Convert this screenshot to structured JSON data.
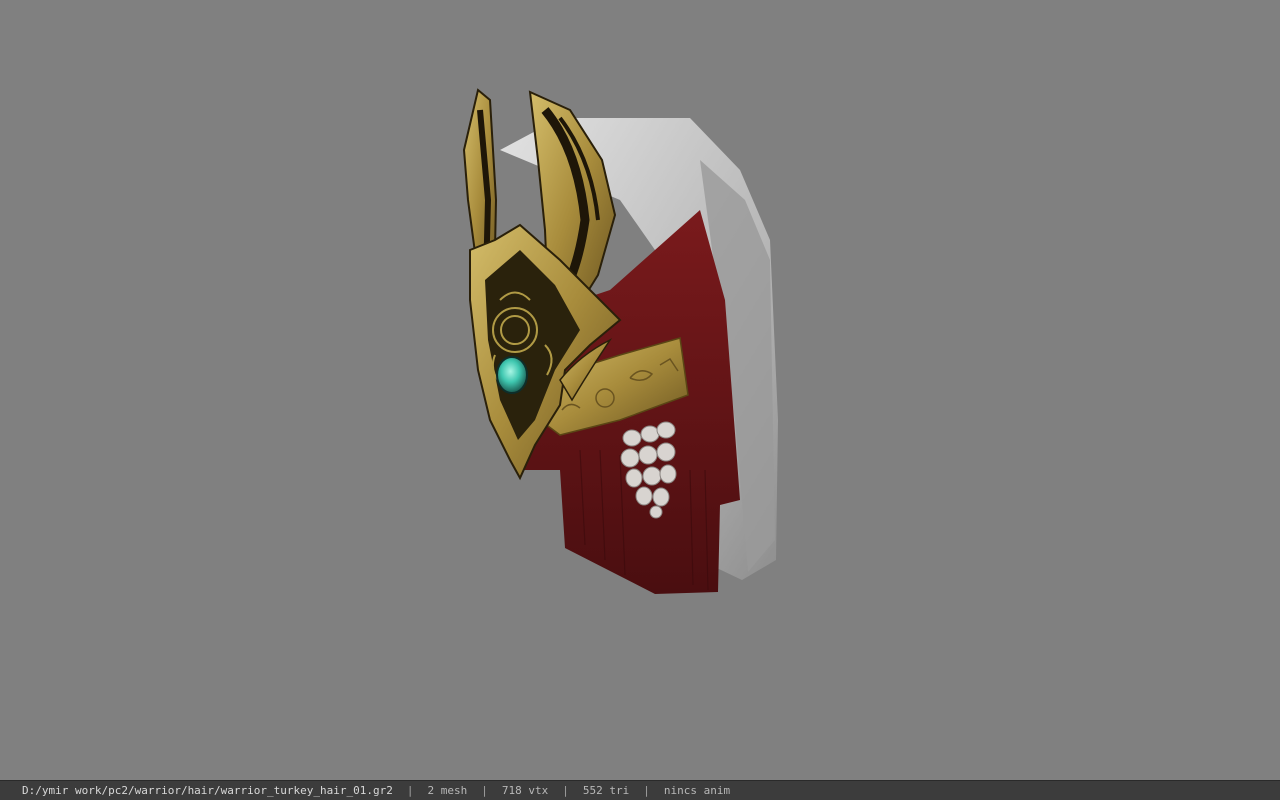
{
  "viewport": {
    "background_color": "#808080",
    "model": {
      "icon": "helmet-model",
      "colors": {
        "gold": "#b09a45",
        "gold_dark": "#4a3a12",
        "gem": "#3fc7b0",
        "cloth_red": "#6a1416",
        "fur_white": "#c8c8c8"
      }
    }
  },
  "statusbar": {
    "file_path": "D:/ymir work/pc2/warrior/hair/warrior_turkey_hair_01.gr2",
    "separator": "|",
    "mesh_count": "2 mesh",
    "vertex_count": "718 vtx",
    "triangle_count": "552 tri",
    "anim_status": "nincs anim"
  }
}
